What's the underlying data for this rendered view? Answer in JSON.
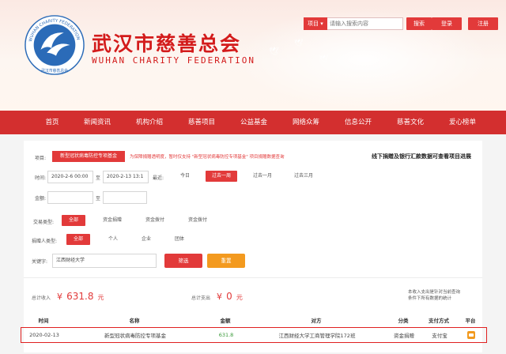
{
  "header": {
    "title_cn": "武汉市慈善总会",
    "title_en": "WUHAN CHARITY FEDERATION",
    "logo_ring_text": "WUHAN CHARITY FEDERATION",
    "logo_bottom_text": "武汉市慈善总会"
  },
  "search": {
    "type_label": "项目",
    "placeholder": "请输入搜索内容",
    "button": "搜索"
  },
  "auth": {
    "login": "登录",
    "register": "注册"
  },
  "nav": [
    "首页",
    "新闻资讯",
    "机构介绍",
    "慈善项目",
    "公益基金",
    "网络众筹",
    "信息公开",
    "慈善文化",
    "爱心榜单"
  ],
  "filters": {
    "project_label": "项目:",
    "project_value": "新型冠状病毒防控专项基金",
    "project_note": "为保障捐赠透明度，暂时仅支持 \"新型冠状病毒防控专项基金\" 项目捐赠数据查询",
    "right_note": "线下捐赠及银行汇款数据可查看项目进展",
    "time_label": "时间:",
    "date_from": "2020-2-6 00:00",
    "date_to": "2020-2-13 13:1",
    "date_sep": "至",
    "recent_label": "最近:",
    "recent_options": [
      "今日",
      "过去一周",
      "过去一月",
      "过去三月"
    ],
    "recent_selected": "过去一周",
    "amount_label": "金额:",
    "amount_sep": "至",
    "trade_type_label": "交易类型:",
    "trade_types": [
      "全部",
      "资金捐赠",
      "资金拨付",
      "资金拨付"
    ],
    "donor_type_label": "捐赠人类型:",
    "donor_types": [
      "全部",
      "个人",
      "企业",
      "团体"
    ],
    "keyword_label": "关键字:",
    "keyword_value": "江西财经大学",
    "filter_button": "筛选",
    "reset_button": "重置"
  },
  "summary": {
    "income_label": "总计收入",
    "income_currency": "¥",
    "income_value": "631.8",
    "income_unit": "元",
    "expense_label": "总计支出",
    "expense_currency": "¥",
    "expense_value": "0",
    "expense_unit": "元",
    "note_line1": "本收入支出是针对当前查询",
    "note_line2": "条件下所有数据的统计"
  },
  "table": {
    "headers": [
      "时间",
      "名称",
      "金额",
      "对方",
      "分类",
      "支付方式",
      "平台"
    ],
    "rows": [
      {
        "time": "2020-02-13",
        "name": "新型冠状病毒防控专项基金",
        "amount": "631.8",
        "counterparty": "江西财经大学工商管理学院172班",
        "category": "资金捐赠",
        "payment": "支付宝",
        "platform_icon": "platform-icon"
      }
    ]
  },
  "colors": {
    "brand_red": "#d32f2f",
    "accent_orange": "#f39a1f",
    "amount_green": "#3a9a3a"
  }
}
